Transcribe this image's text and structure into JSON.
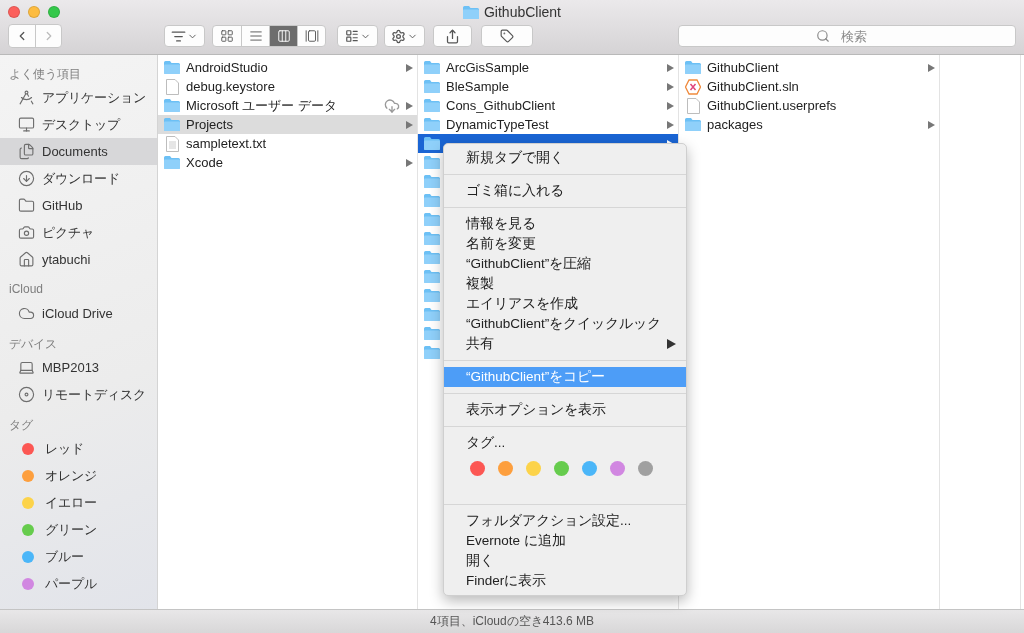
{
  "window": {
    "title": "GithubClient"
  },
  "toolbar": {
    "nav": [
      {
        "kind": "back",
        "disabled": false
      },
      {
        "kind": "forward",
        "disabled": true
      }
    ],
    "view_modes": [
      {
        "kind": "icons",
        "selected": false
      },
      {
        "kind": "list",
        "selected": false
      },
      {
        "kind": "columns",
        "selected": true
      },
      {
        "kind": "gallery",
        "selected": false
      }
    ],
    "search": {
      "placeholder": "検索"
    }
  },
  "sidebar": {
    "sections": [
      {
        "title": "よく使う項目",
        "items": [
          {
            "label": "アプリケーション",
            "kind": "apps",
            "selected": false
          },
          {
            "label": "デスクトップ",
            "kind": "desktop",
            "selected": false
          },
          {
            "label": "Documents",
            "kind": "documents",
            "selected": true
          },
          {
            "label": "ダウンロード",
            "kind": "downloads",
            "selected": false
          },
          {
            "label": "GitHub",
            "kind": "folder",
            "selected": false
          },
          {
            "label": "ピクチャ",
            "kind": "pictures",
            "selected": false
          },
          {
            "label": "ytabuchi",
            "kind": "home",
            "selected": false
          }
        ]
      },
      {
        "title": "iCloud",
        "items": [
          {
            "label": "iCloud Drive",
            "kind": "cloud",
            "selected": false
          }
        ]
      },
      {
        "title": "デバイス",
        "items": [
          {
            "label": "MBP2013",
            "kind": "laptop",
            "selected": false
          },
          {
            "label": "リモートディスク",
            "kind": "disc",
            "selected": false
          }
        ]
      },
      {
        "title": "タグ",
        "items": [
          {
            "label": "レッド",
            "kind": "tag",
            "color": "#fc5753",
            "selected": false
          },
          {
            "label": "オレンジ",
            "kind": "tag",
            "color": "#fd9f3e",
            "selected": false
          },
          {
            "label": "イエロー",
            "kind": "tag",
            "color": "#fcd34a",
            "selected": false
          },
          {
            "label": "グリーン",
            "kind": "tag",
            "color": "#66cc4d",
            "selected": false
          },
          {
            "label": "ブルー",
            "kind": "tag",
            "color": "#4bb6f8",
            "selected": false
          },
          {
            "label": "パープル",
            "kind": "tag",
            "color": "#d187e1",
            "selected": false
          }
        ]
      }
    ]
  },
  "columns": [
    {
      "items": [
        {
          "name": "AndroidStudio",
          "kind": "folder",
          "selected": false
        },
        {
          "name": "debug.keystore",
          "kind": "file",
          "selected": false
        },
        {
          "name": "Microsoft ユーザー データ",
          "kind": "folder",
          "selected": false,
          "downloadable": true
        },
        {
          "name": "Projects",
          "kind": "folder",
          "selected": true
        },
        {
          "name": "sampletext.txt",
          "kind": "text",
          "selected": false
        },
        {
          "name": "Xcode",
          "kind": "folder",
          "selected": false
        }
      ]
    },
    {
      "focused": true,
      "items": [
        {
          "name": "ArcGisSample",
          "kind": "folder",
          "selected": false
        },
        {
          "name": "BleSample",
          "kind": "folder",
          "selected": false
        },
        {
          "name": "Cons_GithubClient",
          "kind": "folder",
          "selected": false
        },
        {
          "name": "DynamicTypeTest",
          "kind": "folder",
          "selected": false
        },
        {
          "kind": "folder",
          "selected": true
        },
        {
          "kind": "folder",
          "selected": false
        },
        {
          "kind": "folder",
          "selected": false
        },
        {
          "kind": "folder",
          "selected": false
        },
        {
          "kind": "folder",
          "selected": false
        },
        {
          "kind": "folder",
          "selected": false
        },
        {
          "kind": "folder",
          "selected": false
        },
        {
          "kind": "folder",
          "selected": false
        },
        {
          "kind": "folder",
          "selected": false
        },
        {
          "kind": "folder",
          "selected": false
        },
        {
          "kind": "folder",
          "selected": false
        },
        {
          "kind": "folder",
          "selected": false
        }
      ]
    },
    {
      "items": [
        {
          "name": "GithubClient",
          "kind": "folder",
          "selected": false
        },
        {
          "name": "GithubClient.sln",
          "kind": "solution",
          "selected": false
        },
        {
          "name": "GithubClient.userprefs",
          "kind": "file",
          "selected": false
        },
        {
          "name": "packages",
          "kind": "folder",
          "selected": false
        }
      ]
    }
  ],
  "context_menu": {
    "sections": [
      {
        "kind": "items",
        "items": [
          {
            "label": "新規タブで開く",
            "selected": false,
            "submenu": false
          }
        ]
      },
      {
        "kind": "items",
        "items": [
          {
            "label": "ゴミ箱に入れる",
            "selected": false,
            "submenu": false
          }
        ]
      },
      {
        "kind": "items",
        "items": [
          {
            "label": "情報を見る",
            "selected": false,
            "submenu": false
          },
          {
            "label": "名前を変更",
            "selected": false,
            "submenu": false
          },
          {
            "label": "“GithubClient”を圧縮",
            "selected": false,
            "submenu": false
          },
          {
            "label": "複製",
            "selected": false,
            "submenu": false
          },
          {
            "label": "エイリアスを作成",
            "selected": false,
            "submenu": false
          },
          {
            "label": "“GithubClient”をクイックルック",
            "selected": false,
            "submenu": false
          },
          {
            "label": "共有",
            "selected": false,
            "submenu": true
          }
        ]
      },
      {
        "kind": "items",
        "items": [
          {
            "label": "“GithubClient”をコピー",
            "selected": true,
            "submenu": false
          }
        ]
      },
      {
        "kind": "items",
        "items": [
          {
            "label": "表示オプションを表示",
            "selected": false,
            "submenu": false
          }
        ]
      },
      {
        "kind": "tags",
        "label": "タグ...",
        "dots": [
          {
            "color": "#fc5753"
          },
          {
            "color": "#fd9f3e"
          },
          {
            "color": "#fcd34a"
          },
          {
            "color": "#66cc4d"
          },
          {
            "color": "#4bb6f8"
          },
          {
            "color": "#d187e1"
          },
          {
            "color": "#a0a0a0"
          }
        ]
      },
      {
        "kind": "items",
        "items": [
          {
            "label": "フォルダアクション設定...",
            "selected": false,
            "submenu": false
          },
          {
            "label": "Evernote に追加",
            "selected": false,
            "submenu": false
          },
          {
            "label": "開く",
            "selected": false,
            "submenu": false
          },
          {
            "label": "Finderに表示",
            "selected": false,
            "submenu": false
          }
        ]
      }
    ]
  },
  "status_bar": {
    "text": "4項目、iCloudの空き413.6 MB"
  }
}
